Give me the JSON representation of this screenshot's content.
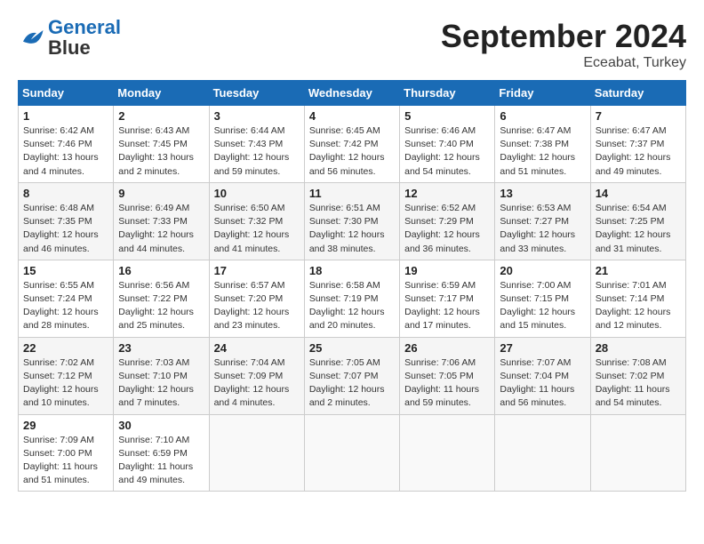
{
  "header": {
    "logo_general": "General",
    "logo_blue": "Blue",
    "month_title": "September 2024",
    "location": "Eceabat, Turkey"
  },
  "weekdays": [
    "Sunday",
    "Monday",
    "Tuesday",
    "Wednesday",
    "Thursday",
    "Friday",
    "Saturday"
  ],
  "weeks": [
    [
      {
        "day": 1,
        "sunrise": "6:42 AM",
        "sunset": "7:46 PM",
        "daylight": "13 hours and 4 minutes."
      },
      {
        "day": 2,
        "sunrise": "6:43 AM",
        "sunset": "7:45 PM",
        "daylight": "13 hours and 2 minutes."
      },
      {
        "day": 3,
        "sunrise": "6:44 AM",
        "sunset": "7:43 PM",
        "daylight": "12 hours and 59 minutes."
      },
      {
        "day": 4,
        "sunrise": "6:45 AM",
        "sunset": "7:42 PM",
        "daylight": "12 hours and 56 minutes."
      },
      {
        "day": 5,
        "sunrise": "6:46 AM",
        "sunset": "7:40 PM",
        "daylight": "12 hours and 54 minutes."
      },
      {
        "day": 6,
        "sunrise": "6:47 AM",
        "sunset": "7:38 PM",
        "daylight": "12 hours and 51 minutes."
      },
      {
        "day": 7,
        "sunrise": "6:47 AM",
        "sunset": "7:37 PM",
        "daylight": "12 hours and 49 minutes."
      }
    ],
    [
      {
        "day": 8,
        "sunrise": "6:48 AM",
        "sunset": "7:35 PM",
        "daylight": "12 hours and 46 minutes."
      },
      {
        "day": 9,
        "sunrise": "6:49 AM",
        "sunset": "7:33 PM",
        "daylight": "12 hours and 44 minutes."
      },
      {
        "day": 10,
        "sunrise": "6:50 AM",
        "sunset": "7:32 PM",
        "daylight": "12 hours and 41 minutes."
      },
      {
        "day": 11,
        "sunrise": "6:51 AM",
        "sunset": "7:30 PM",
        "daylight": "12 hours and 38 minutes."
      },
      {
        "day": 12,
        "sunrise": "6:52 AM",
        "sunset": "7:29 PM",
        "daylight": "12 hours and 36 minutes."
      },
      {
        "day": 13,
        "sunrise": "6:53 AM",
        "sunset": "7:27 PM",
        "daylight": "12 hours and 33 minutes."
      },
      {
        "day": 14,
        "sunrise": "6:54 AM",
        "sunset": "7:25 PM",
        "daylight": "12 hours and 31 minutes."
      }
    ],
    [
      {
        "day": 15,
        "sunrise": "6:55 AM",
        "sunset": "7:24 PM",
        "daylight": "12 hours and 28 minutes."
      },
      {
        "day": 16,
        "sunrise": "6:56 AM",
        "sunset": "7:22 PM",
        "daylight": "12 hours and 25 minutes."
      },
      {
        "day": 17,
        "sunrise": "6:57 AM",
        "sunset": "7:20 PM",
        "daylight": "12 hours and 23 minutes."
      },
      {
        "day": 18,
        "sunrise": "6:58 AM",
        "sunset": "7:19 PM",
        "daylight": "12 hours and 20 minutes."
      },
      {
        "day": 19,
        "sunrise": "6:59 AM",
        "sunset": "7:17 PM",
        "daylight": "12 hours and 17 minutes."
      },
      {
        "day": 20,
        "sunrise": "7:00 AM",
        "sunset": "7:15 PM",
        "daylight": "12 hours and 15 minutes."
      },
      {
        "day": 21,
        "sunrise": "7:01 AM",
        "sunset": "7:14 PM",
        "daylight": "12 hours and 12 minutes."
      }
    ],
    [
      {
        "day": 22,
        "sunrise": "7:02 AM",
        "sunset": "7:12 PM",
        "daylight": "12 hours and 10 minutes."
      },
      {
        "day": 23,
        "sunrise": "7:03 AM",
        "sunset": "7:10 PM",
        "daylight": "12 hours and 7 minutes."
      },
      {
        "day": 24,
        "sunrise": "7:04 AM",
        "sunset": "7:09 PM",
        "daylight": "12 hours and 4 minutes."
      },
      {
        "day": 25,
        "sunrise": "7:05 AM",
        "sunset": "7:07 PM",
        "daylight": "12 hours and 2 minutes."
      },
      {
        "day": 26,
        "sunrise": "7:06 AM",
        "sunset": "7:05 PM",
        "daylight": "11 hours and 59 minutes."
      },
      {
        "day": 27,
        "sunrise": "7:07 AM",
        "sunset": "7:04 PM",
        "daylight": "11 hours and 56 minutes."
      },
      {
        "day": 28,
        "sunrise": "7:08 AM",
        "sunset": "7:02 PM",
        "daylight": "11 hours and 54 minutes."
      }
    ],
    [
      {
        "day": 29,
        "sunrise": "7:09 AM",
        "sunset": "7:00 PM",
        "daylight": "11 hours and 51 minutes."
      },
      {
        "day": 30,
        "sunrise": "7:10 AM",
        "sunset": "6:59 PM",
        "daylight": "11 hours and 49 minutes."
      },
      null,
      null,
      null,
      null,
      null
    ]
  ]
}
